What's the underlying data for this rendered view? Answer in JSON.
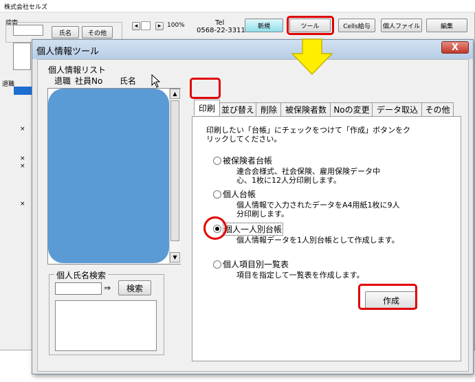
{
  "main_window": {
    "title": "株式会社セルズ",
    "search_group": "検索",
    "name_btn": "氏名",
    "other_btn": "その他",
    "zoom_level": "100%",
    "tel_label": "Tel",
    "tel_number": "0568-22-3311",
    "toolbar": [
      "新規",
      "ツール",
      "Cells給与",
      "個人ファイル",
      "編集"
    ],
    "retire_header": "退職",
    "mark": "×"
  },
  "dialog": {
    "title": "個人情報ツール",
    "close": "X",
    "list": {
      "group_label": "個人情報リスト",
      "col_retire": "退職",
      "col_empno": "社員No",
      "col_name": "氏名"
    },
    "search": {
      "legend": "個人氏名検索",
      "arrow": "⇒",
      "button": "検索"
    },
    "tabs": [
      "印刷",
      "並び替え",
      "削除",
      "被保険者数",
      "Noの変更",
      "データ取込",
      "その他"
    ],
    "print_tab": {
      "instruction_line1": "印刷したい「台帳」にチェックをつけて「作成」ボタンをク",
      "instruction_line2": "リックしてください。",
      "options": [
        {
          "label": "被保険者台帳",
          "desc1": "連合会様式、社会保険、雇用保険データ中",
          "desc2": "心、1枚に12人分印刷します。",
          "selected": false
        },
        {
          "label": "個人台帳",
          "desc1": "個人情報で入力されたデータをA4用紙1枚に9人",
          "desc2": "分印刷します。",
          "selected": false
        },
        {
          "label": "個人一人別台帳",
          "desc1": "個人情報データを1人別台帳として作成します。",
          "desc2": "",
          "selected": true
        },
        {
          "label": "個人項目別一覧表",
          "desc1": "項目を指定して一覧表を作成します。",
          "desc2": "",
          "selected": false
        }
      ],
      "create_button": "作成"
    }
  },
  "colors": {
    "highlight_red": "#e00000",
    "arrow_yellow": "#ffee00",
    "list_blue": "#5b9bd5"
  }
}
